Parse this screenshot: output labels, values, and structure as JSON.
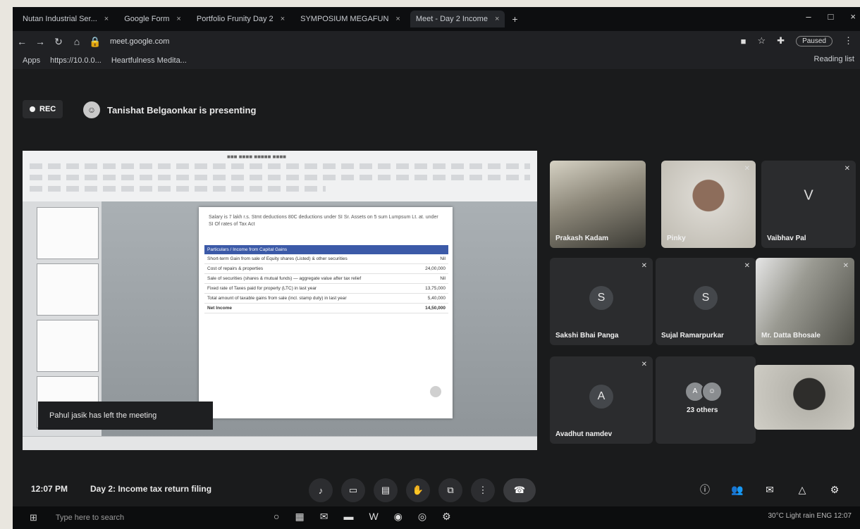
{
  "tabs": [
    {
      "label": "Nutan Industrial Ser...",
      "active": false
    },
    {
      "label": "Google Form",
      "active": false
    },
    {
      "label": "Portfolio Frunity Day 2",
      "active": false
    },
    {
      "label": "SYMPOSIUM MEGAFUN",
      "active": false
    },
    {
      "label": "Meet - Day 2 Income",
      "active": true
    }
  ],
  "address": {
    "url": "meet.google.com"
  },
  "toolbar": {
    "profile_label": "Paused"
  },
  "bookmarks": {
    "apps": "Apps",
    "item1": "https://10.0.0...",
    "item2": "Heartfulness Medita...",
    "reading_list": "Reading list"
  },
  "meet": {
    "rec_label": "REC",
    "presenter_text": "Tanishat Belgaonkar is presenting",
    "toast": "Pahul jasik has left the meeting",
    "clock": "12:07 PM",
    "meeting_title": "Day 2: Income tax return filing"
  },
  "slide": {
    "intro": "Salary is 7 lakh  r.s.  Stmt deductions  80C deductions  under SI  Sr. Assets on 5 sum Lumpsum  Lt. at. under SI  Of rates of Tax Act",
    "header": "Particulars / Income from Capital Gains",
    "rows": [
      {
        "label": "Short-term Gain from sale of Equity shares (Listed) & other securities",
        "value": "Nil"
      },
      {
        "label": "Cost of repairs & properties",
        "value": "24,00,000"
      },
      {
        "label": "Sale of securities (shares & mutual funds) — aggregate value after tax relief",
        "value": "Nil"
      },
      {
        "label": "Fixed rate of Taxes paid for property (LTC) in last year",
        "value": "13,75,000"
      },
      {
        "label": "Total amount of taxable gains from sale (incl. stamp duty) in last year",
        "value": "5,40,000"
      },
      {
        "label": "Net Income",
        "value": "14,50,000",
        "total": true
      }
    ]
  },
  "participants": [
    {
      "name": "Prakash Kadam",
      "type": "video"
    },
    {
      "name": "Pinky",
      "type": "video"
    },
    {
      "name": "Vaibhav Pal",
      "type": "letter",
      "letter": "V"
    },
    {
      "name": "Sakshi Bhai Panga",
      "type": "letter",
      "letter": "S"
    },
    {
      "name": "Sujal Ramarpurkar",
      "type": "letter",
      "letter": "S"
    },
    {
      "name": "Mr. Datta Bhosale",
      "type": "video"
    },
    {
      "name": "Avadhut namdev",
      "type": "letter",
      "letter": "A"
    },
    {
      "name": "23 others",
      "type": "others"
    },
    {
      "name": "",
      "type": "video"
    }
  ],
  "taskbar": {
    "search": "Type here to search",
    "tray": "30°C  Light rain  ENG  12:07"
  }
}
